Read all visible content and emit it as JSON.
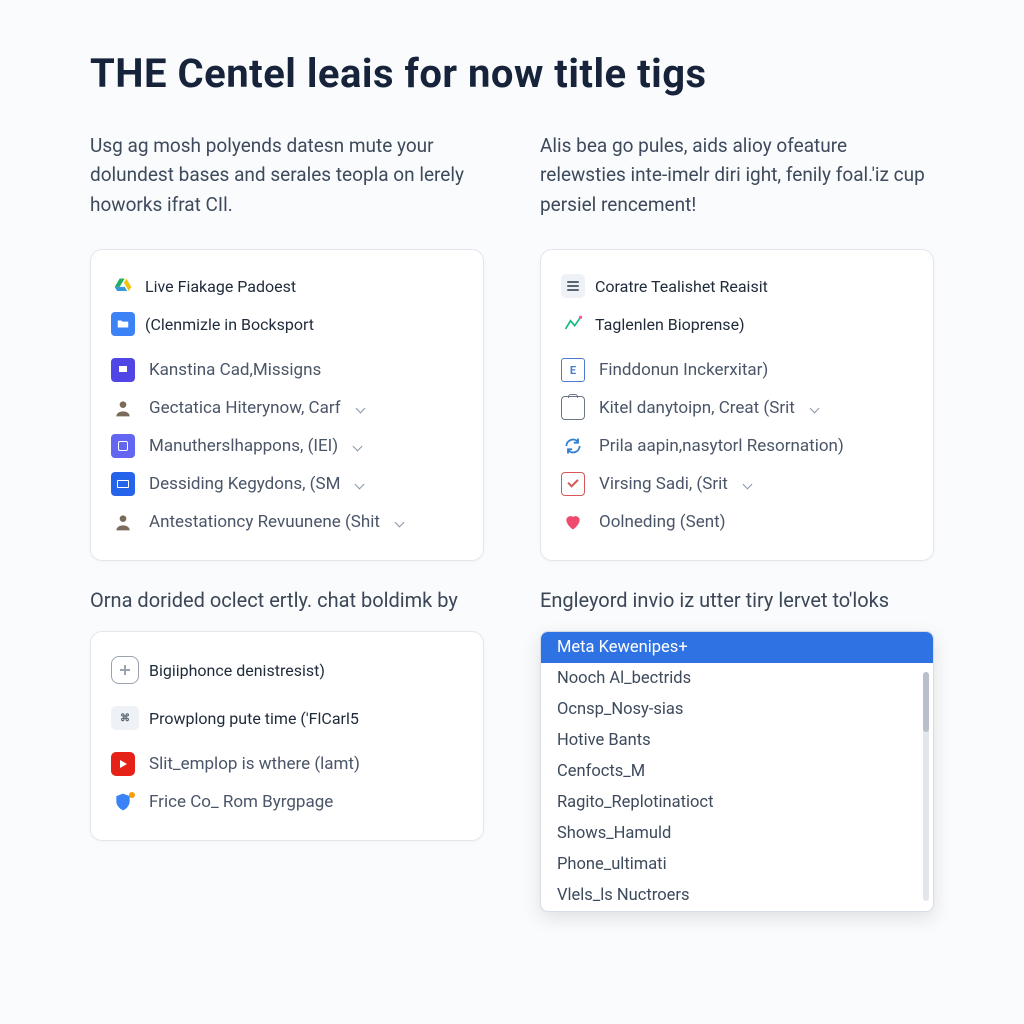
{
  "title": "THE Centel leais for now title tigs",
  "left": {
    "intro": "Usg ag mosh polyends datesn mute your dolundest bases and serales teopla on lerely howorks ifrat CIl.",
    "card1": {
      "tags": [
        "Live Fiakage Padoest",
        "(Clenmizle in Bocksport"
      ],
      "items": [
        "Kanstina Cad,Missigns",
        "Gectatica Hiterynow, Carf",
        "Manutherslhappons, (IEI)",
        "Dessiding Kegydons, (SM",
        "Antestationcy Revuunene (Shit"
      ]
    },
    "caption2": "Orna dorided oclect ertly. chat boldimk by",
    "card2": {
      "tags": [
        "Bigiiphonce denistresist)",
        "Prowplong pute time ('FlCarl5"
      ],
      "items": [
        "Slit_emplop is wthere (lamt)",
        "Frice Co_ Rom Byrgpage"
      ]
    }
  },
  "right": {
    "intro": "Alis bea go pules, aids alioy ofeature relewsties inte-imelr diri ight, fenily foal.'iz cup persiel rencement!",
    "card1": {
      "tags": [
        "Coratre Tealishet Reaisit",
        "Taglenlen Bioprense)"
      ],
      "items": [
        "Finddonun Inckerxitar)",
        "Kitel danytoipn, Creat (Srit",
        "Prila aapin,nasytorl Resornation)",
        "Virsing Sadi, (Srit",
        "Oolneding (Sent)"
      ]
    },
    "caption2": "Engleyord invio iz utter tiry lervet to'loks",
    "dropdown": {
      "selected": "Meta Kewenipes+",
      "options": [
        "Nooch Al_bectrids",
        "Ocnsp_Nosy-sias",
        "Hotive Bants",
        "Cenfocts_M",
        "Ragito_Replotinatioct",
        "Shows_Hamuld",
        "Phone_ultimati",
        "Vlels_ls Nuctroers"
      ]
    }
  }
}
